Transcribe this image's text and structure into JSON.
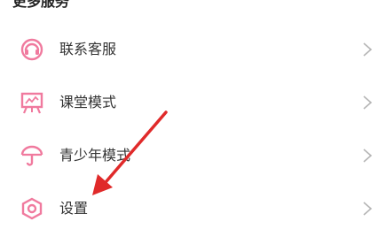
{
  "section": {
    "title": "更多服务"
  },
  "menu": {
    "items": [
      {
        "label": "联系客服",
        "icon": "headset-icon"
      },
      {
        "label": "课堂模式",
        "icon": "classroom-board-icon"
      },
      {
        "label": "青少年模式",
        "icon": "umbrella-icon"
      },
      {
        "label": "设置",
        "icon": "hexagon-settings-icon"
      }
    ]
  },
  "colors": {
    "accent": "#f07a9e",
    "arrow": "#e02a2a",
    "chevron": "#b5b5b5",
    "text": "#333333"
  }
}
